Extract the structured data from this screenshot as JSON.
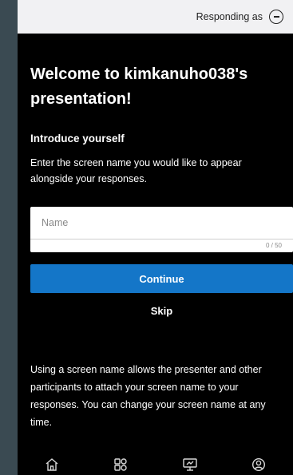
{
  "header": {
    "responding_label": "Responding as",
    "profile_icon": "minus-circle-icon"
  },
  "main": {
    "welcome_title": "Welcome to kimkanuho038's presentation!",
    "intro_heading": "Introduce yourself",
    "intro_description": "Enter the screen name you would like to appear alongside your responses.",
    "name_field": {
      "placeholder": "Name",
      "value": "",
      "counter": "0 / 50"
    },
    "continue_label": "Continue",
    "skip_label": "Skip",
    "note": "Using a screen name allows the presenter and other participants to attach your screen name to your responses. You can change your screen name at any time."
  },
  "bottom_nav": {
    "icons": [
      "home-icon",
      "shapes-icon",
      "presentation-icon",
      "profile-icon"
    ]
  },
  "colors": {
    "background": "#000000",
    "header_bg": "#f1f1f3",
    "accent": "#1476c8",
    "field_bg": "#ffffff"
  }
}
